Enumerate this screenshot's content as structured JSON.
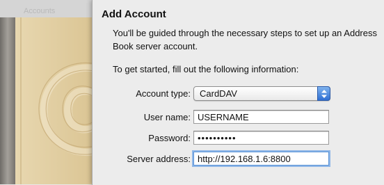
{
  "background": {
    "faint_label": "Accounts"
  },
  "sheet": {
    "title": "Add Account",
    "intro": "You'll be guided through the necessary steps to set up an Address Book server account.",
    "prompt": "To get started, fill out the following information:"
  },
  "form": {
    "account_type": {
      "label": "Account type:",
      "value": "CardDAV"
    },
    "user_name": {
      "label": "User name:",
      "value": "USERNAME"
    },
    "password": {
      "label": "Password:",
      "value": "••••••••••"
    },
    "server_address": {
      "label": "Server address:",
      "value": "http://192.168.1.6:8800"
    }
  },
  "colors": {
    "accent": "#3b7be0",
    "book_cover": "#e2cfa3",
    "book_spine": "#8d8a85"
  },
  "icons": [
    "address-book-icon",
    "at-sign-icon",
    "popup-arrows-icon"
  ]
}
